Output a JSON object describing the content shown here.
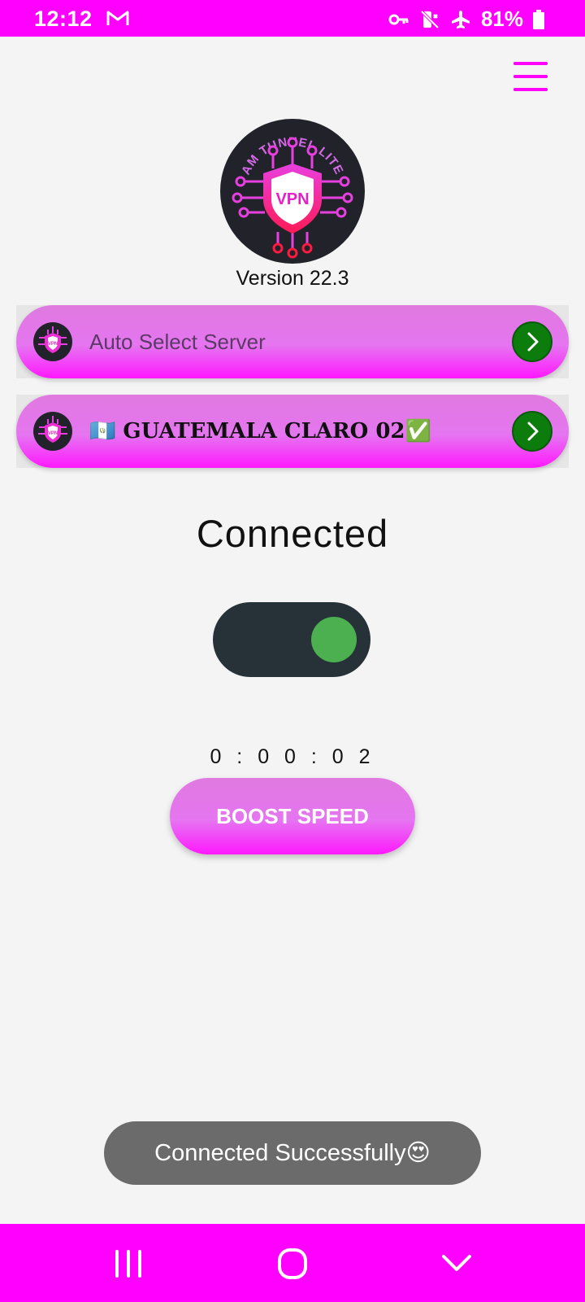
{
  "status_bar": {
    "time": "12:12",
    "battery": "81%",
    "icons": [
      "gmail-icon",
      "vpn-key-icon",
      "mute-icon",
      "airplane-icon",
      "battery-icon"
    ]
  },
  "app": {
    "version": "Version 22.3",
    "logo_text": "AM TUNNEL LITE",
    "logo_badge": "VPN"
  },
  "servers": [
    {
      "label": "Auto Select Server"
    },
    {
      "label": "🇬🇹 GUATEMALA CLARO 02✅"
    }
  ],
  "connection": {
    "status": "Connected",
    "timer": "0 : 0 0 : 0 2"
  },
  "boost": {
    "label": "BOOST SPEED"
  },
  "toast": {
    "message": "Connected Successfully😍"
  },
  "colors": {
    "accent": "#ff00ff",
    "toggle_track": "#263238",
    "toggle_knob": "#4caf50",
    "arrow_button": "#0c7d0c",
    "toast_bg": "#6b6b6b"
  }
}
